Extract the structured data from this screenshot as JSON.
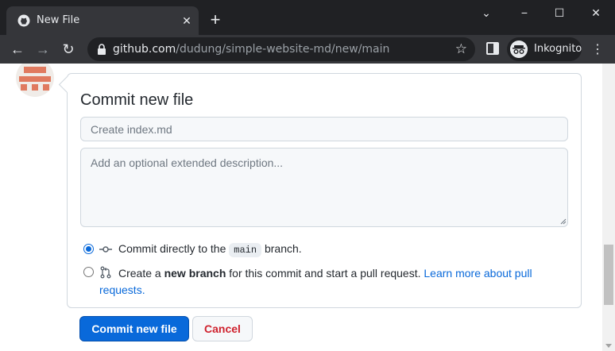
{
  "browser": {
    "tab_title": "New File",
    "new_tab_symbol": "+",
    "url_host": "github.com",
    "url_path": "/dudung/simple-website-md/new/main",
    "incognito_label": "Inkognito"
  },
  "commit": {
    "heading": "Commit new file",
    "summary_placeholder": "Create index.md",
    "summary_value": "",
    "description_placeholder": "Add an optional extended description...",
    "description_value": "",
    "option_direct": {
      "text_before": "Commit directly to the",
      "branch": "main",
      "text_after": "branch.",
      "selected": true
    },
    "option_new_branch": {
      "text_before": "Create a",
      "bold": "new branch",
      "text_middle": "for this commit and start a pull request.",
      "link_line1": "Learn more about pull",
      "link_line2": "requests.",
      "selected": false
    },
    "commit_button": "Commit new file",
    "cancel_button": "Cancel"
  },
  "colors": {
    "primary": "#0969da",
    "danger": "#cf222e",
    "avatar": "#e07a5f"
  },
  "icons": {
    "tab_favicon": "github-icon",
    "lock": "lock-icon",
    "star": "star-icon",
    "commit": "git-commit-icon",
    "pull_request": "git-pull-request-icon"
  }
}
